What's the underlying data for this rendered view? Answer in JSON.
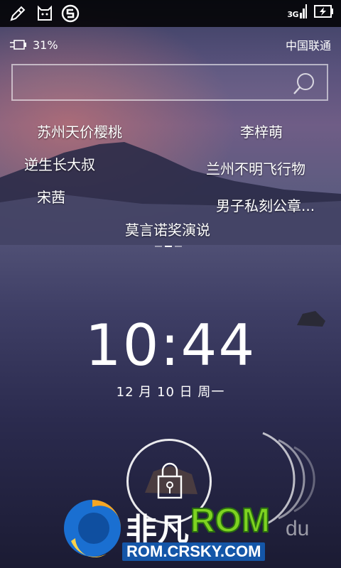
{
  "status_bar": {
    "network_type": "3G",
    "icons": [
      "edit-icon",
      "bear-notification-icon",
      "s-app-icon",
      "signal-3g-icon",
      "battery-charging-icon"
    ]
  },
  "info": {
    "battery_percent": "31%",
    "carrier": "中国联通"
  },
  "search": {
    "placeholder": ""
  },
  "hot_words": [
    "苏州天价樱桃",
    "李梓萌",
    "逆生长大叔",
    "兰州不明飞行物",
    "宋茜",
    "男子私刻公章...",
    "莫言诺奖演说"
  ],
  "clock": {
    "time": "10:44",
    "date": "12 月 10 日 周一"
  },
  "watermark": {
    "brand_cn": "非凡",
    "brand_rom": "ROM",
    "url": "ROM.CRSKY.COM",
    "du": "du"
  }
}
